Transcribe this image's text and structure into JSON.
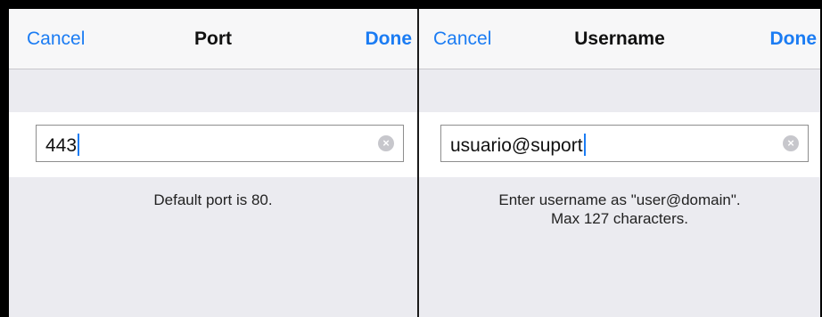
{
  "left_panel": {
    "cancel_label": "Cancel",
    "title": "Port",
    "done_label": "Done",
    "field_value": "443",
    "hint_line1": "Default port is 80."
  },
  "right_panel": {
    "cancel_label": "Cancel",
    "title": "Username",
    "done_label": "Done",
    "field_value": "usuario@suport",
    "hint_line1": "Enter username as \"user@domain\".",
    "hint_line2": "Max 127 characters."
  },
  "colors": {
    "accent": "#1b7cf3",
    "background": "#ebebf0",
    "navbar": "#f7f7f8",
    "clear_icon": "#c7c7cc"
  },
  "icons": {
    "clear": "clear-circle-x-icon"
  }
}
